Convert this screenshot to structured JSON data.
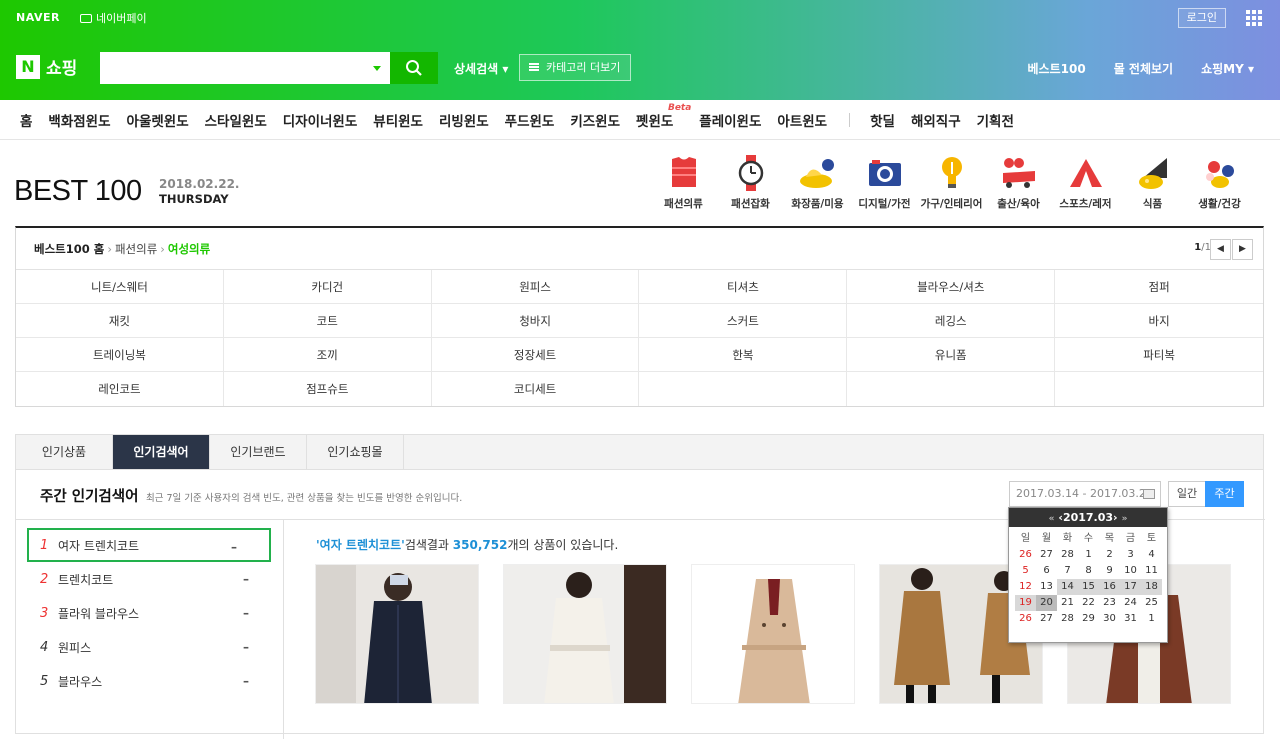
{
  "topbar": {
    "naver": "NAVER",
    "npay": "네이버페이",
    "login": "로그인"
  },
  "header": {
    "shop_logo": "쇼핑",
    "search_placeholder": "",
    "detail_search": "상세검색 ▾",
    "category_more": "카테고리 더보기",
    "right_links": [
      "베스트100",
      "몰 전체보기",
      "쇼핑MY ▾"
    ]
  },
  "nav": {
    "items": [
      "홈",
      "백화점윈도",
      "아울렛윈도",
      "스타일윈도",
      "디자이너윈도",
      "뷰티윈도",
      "리빙윈도",
      "푸드윈도",
      "키즈윈도",
      "펫윈도",
      "플레이윈도",
      "아트윈도"
    ],
    "beta": "Beta",
    "extra": [
      "핫딜",
      "해외직구",
      "기획전"
    ]
  },
  "best": {
    "title": "BEST 100",
    "date": "2018.02.22.",
    "day": "THURSDAY",
    "categories": [
      "패션의류",
      "패션잡화",
      "화장품/미용",
      "디지털/가전",
      "가구/인테리어",
      "출산/육아",
      "스포츠/레저",
      "식품",
      "생활/건강"
    ]
  },
  "crumb": {
    "home": "베스트100 홈",
    "mid": "패션의류",
    "current": "여성의류",
    "page_cur": "1",
    "page_total": "/1"
  },
  "subcategories": [
    "니트/스웨터",
    "카디건",
    "원피스",
    "티셔츠",
    "블라우스/셔츠",
    "점퍼",
    "재킷",
    "코트",
    "청바지",
    "스커트",
    "레깅스",
    "바지",
    "트레이닝복",
    "조끼",
    "정장세트",
    "한복",
    "유니폼",
    "파티복",
    "레인코트",
    "점프슈트",
    "코디세트",
    "",
    "",
    ""
  ],
  "tabs": [
    "인기상품",
    "인기검색어",
    "인기브랜드",
    "인기쇼핑몰"
  ],
  "weekly": {
    "title": "주간 인기검색어",
    "desc": "최근 7일 기준 사용자의 검색 빈도, 관련 상품을 찾는 빈도를 반영한 순위입니다.",
    "date_range": "2017.03.14 - 2017.03.20",
    "btn_day": "일간",
    "btn_week": "주간"
  },
  "ranks": [
    {
      "n": "1",
      "label": "여자 트렌치코트",
      "change": "–"
    },
    {
      "n": "2",
      "label": "트렌치코트",
      "change": "–"
    },
    {
      "n": "3",
      "label": "플라워 블라우스",
      "change": "–"
    },
    {
      "n": "4",
      "label": "원피스",
      "change": "–"
    },
    {
      "n": "5",
      "label": "블라우스",
      "change": "–"
    }
  ],
  "result": {
    "keyword": "'여자 트렌치코트'",
    "mid": "검색결과 ",
    "count": "350,752",
    "tail": "개의 상품이 있습니다."
  },
  "calendar": {
    "month": "2017.03",
    "weekdays": [
      "일",
      "월",
      "화",
      "수",
      "목",
      "금",
      "토"
    ],
    "days": [
      "26",
      "27",
      "28",
      "1",
      "2",
      "3",
      "4",
      "5",
      "6",
      "7",
      "8",
      "9",
      "10",
      "11",
      "12",
      "13",
      "14",
      "15",
      "16",
      "17",
      "18",
      "19",
      "20",
      "21",
      "22",
      "23",
      "24",
      "25",
      "26",
      "27",
      "28",
      "29",
      "30",
      "31",
      "1"
    ]
  }
}
